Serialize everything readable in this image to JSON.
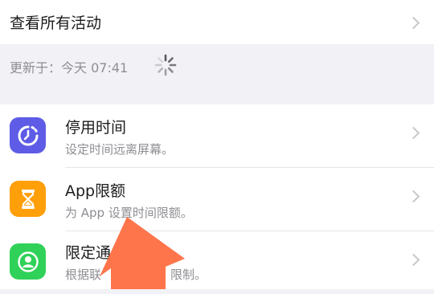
{
  "activity": {
    "label": "查看所有活动"
  },
  "updated": {
    "text": "更新于：今天 07:41"
  },
  "items": [
    {
      "title": "停用时间",
      "subtitle": "设定时间远离屏幕。",
      "icon": "downtime-icon",
      "color": "#5e5ce6"
    },
    {
      "title": "App限额",
      "subtitle": "为 App 设置时间限额。",
      "icon": "hourglass-icon",
      "color": "#ff9f0a"
    },
    {
      "title": "限定通",
      "subtitle": "根据联",
      "subtitle_tail": "限制。",
      "icon": "contact-icon",
      "color": "#30d158"
    }
  ],
  "pointer_color": "#ff6a3d"
}
